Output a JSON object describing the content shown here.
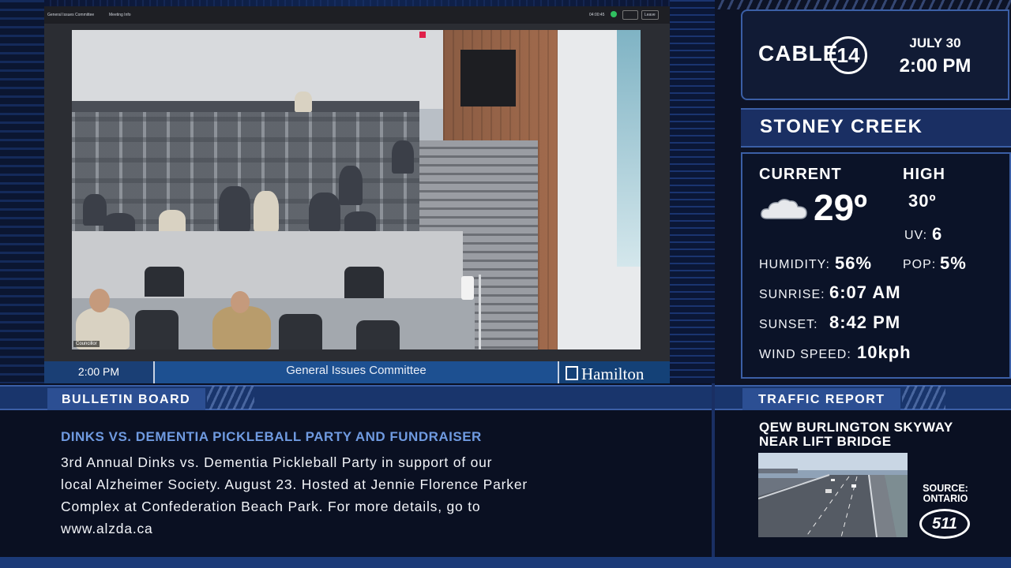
{
  "meeting": {
    "window_title": "General Issues Committee",
    "meeting_info": "Meeting Info",
    "clock": "04:00:45",
    "leave_label": "Leave",
    "nameplate": "Councillor"
  },
  "lower_third": {
    "time": "2:00 PM",
    "committee": "General Issues Committee",
    "logo": "Hamilton"
  },
  "header": {
    "brand": "CABLE",
    "channel": "14",
    "date": "JULY 30",
    "time": "2:00 PM"
  },
  "weather": {
    "city": "STONEY CREEK",
    "current_label": "CURRENT",
    "current_temp": "29º",
    "icon": "cloud-icon",
    "high_label": "HIGH",
    "high_temp": "30º",
    "uv_label": "UV:",
    "uv_value": "6",
    "humidity_label": "HUMIDITY:",
    "humidity_value": "56%",
    "pop_label": "POP:",
    "pop_value": "5%",
    "sunrise_label": "SUNRISE:",
    "sunrise_value": "6:07 AM",
    "sunset_label": "SUNSET:",
    "sunset_value": "8:42 PM",
    "wind_label": "WIND SPEED:",
    "wind_value": "10kph"
  },
  "bulletin": {
    "label": "BULLETIN BOARD",
    "title": "DINKS VS. DEMENTIA PICKLEBALL PARTY AND FUNDRAISER",
    "lines": [
      "3rd Annual Dinks vs. Dementia Pickleball Party in support of our",
      "local Alzheimer Society. August 23. Hosted at Jennie Florence Parker",
      "Complex at Confederation Beach Park. For more details, go to",
      "www.alzda.ca"
    ]
  },
  "traffic": {
    "label": "TRAFFIC REPORT",
    "location_line1": "QEW BURLINGTON SKYWAY",
    "location_line2": "NEAR LIFT BRIDGE",
    "source_line1": "SOURCE:",
    "source_line2": "ONTARIO",
    "logo": "511"
  },
  "colors": {
    "accent_blue": "#3b5fa6",
    "bulletin_title": "#6f9ae0",
    "bar_blue": "#19356c"
  }
}
